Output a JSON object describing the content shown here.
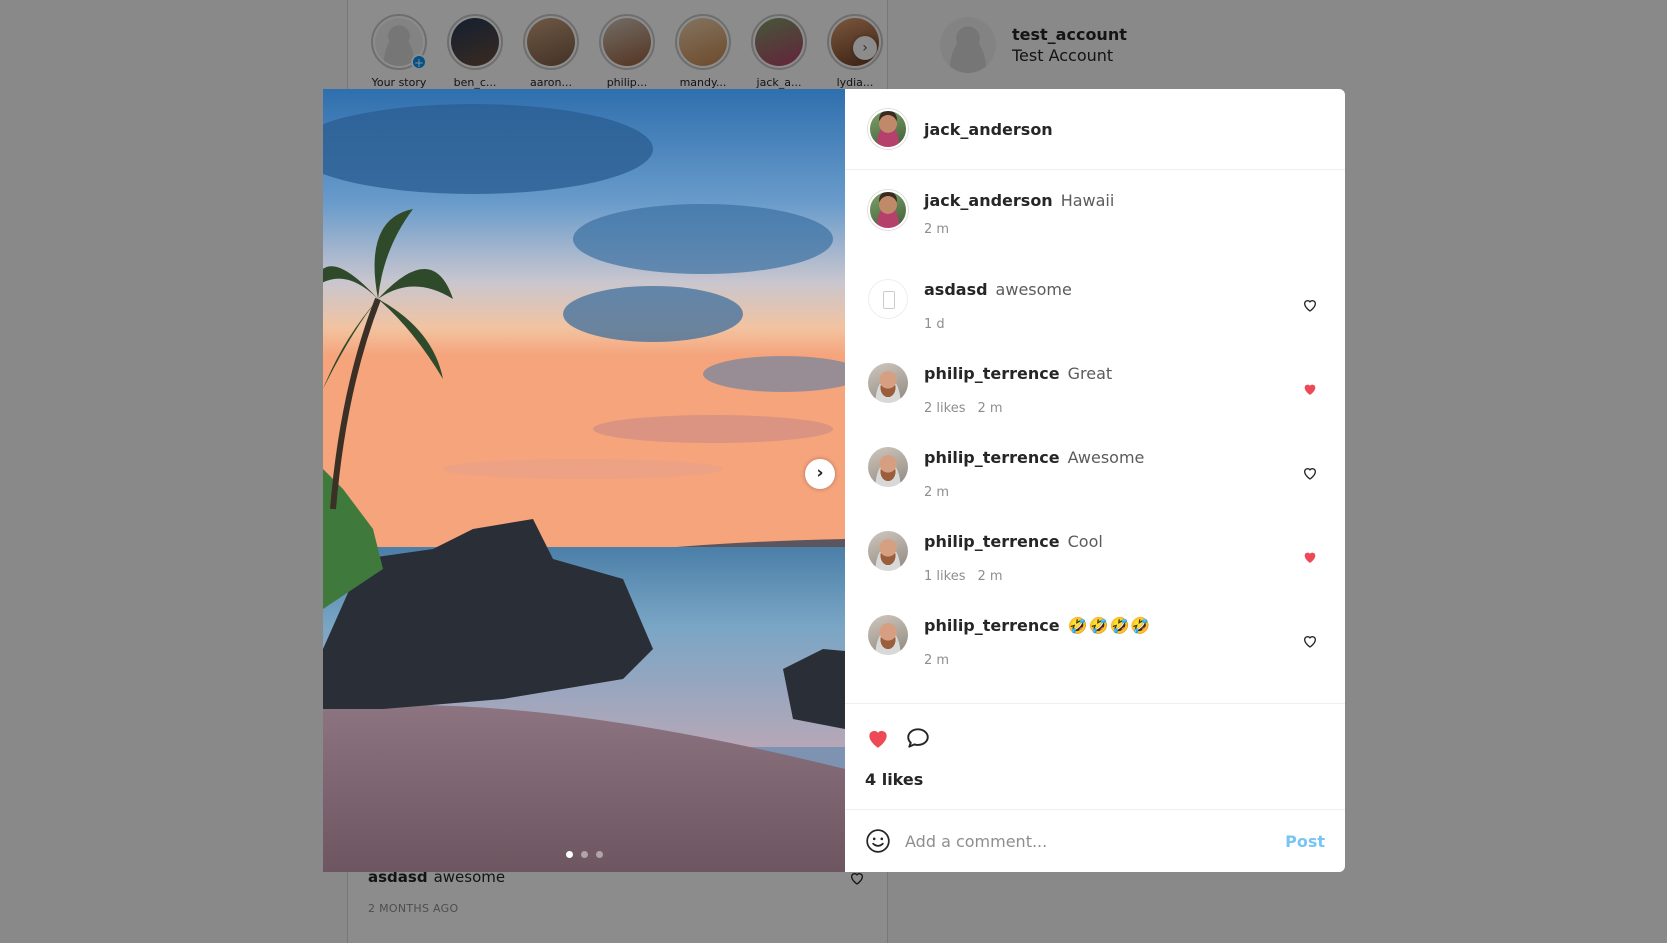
{
  "feed": {
    "stories": [
      {
        "name": "Your story",
        "self": true
      },
      {
        "name": "ben_c...",
        "self": false
      },
      {
        "name": "aaron...",
        "self": false
      },
      {
        "name": "philip...",
        "self": false
      },
      {
        "name": "mandy...",
        "self": false
      },
      {
        "name": "jack_a...",
        "self": false
      },
      {
        "name": "lydia...",
        "self": false
      }
    ],
    "stories_next_glyph": "›",
    "bottom_comment": {
      "username": "asdasd",
      "text": "awesome"
    },
    "bottom_time": "2 MONTHS AGO"
  },
  "profile": {
    "username": "test_account",
    "name": "Test Account"
  },
  "modal": {
    "header_username": "jack_anderson",
    "caption": {
      "username": "jack_anderson",
      "text": "Hawaii",
      "time": "2 m"
    },
    "comments": [
      {
        "username": "asdasd",
        "text": "awesome",
        "likes": "",
        "time": "1 d",
        "liked": false,
        "avatar": "empty"
      },
      {
        "username": "philip_terrence",
        "text": "Great",
        "likes": "2 likes",
        "time": "2 m",
        "liked": true,
        "avatar": "phil"
      },
      {
        "username": "philip_terrence",
        "text": "Awesome",
        "likes": "",
        "time": "2 m",
        "liked": false,
        "avatar": "phil"
      },
      {
        "username": "philip_terrence",
        "text": "Cool",
        "likes": "1 likes",
        "time": "2 m",
        "liked": true,
        "avatar": "phil"
      },
      {
        "username": "philip_terrence",
        "text": "🤣🤣🤣🤣",
        "likes": "",
        "time": "2 m",
        "liked": false,
        "avatar": "phil"
      }
    ],
    "likes": "4 likes",
    "comment_placeholder": "Add a comment...",
    "post_label": "Post",
    "media_next_glyph": "›",
    "carousel_count": 3,
    "carousel_active": 0,
    "colors": {
      "heart_red": "#ed4956",
      "post_blue": "#78c5f5",
      "link_blue": "#0095f6"
    }
  }
}
